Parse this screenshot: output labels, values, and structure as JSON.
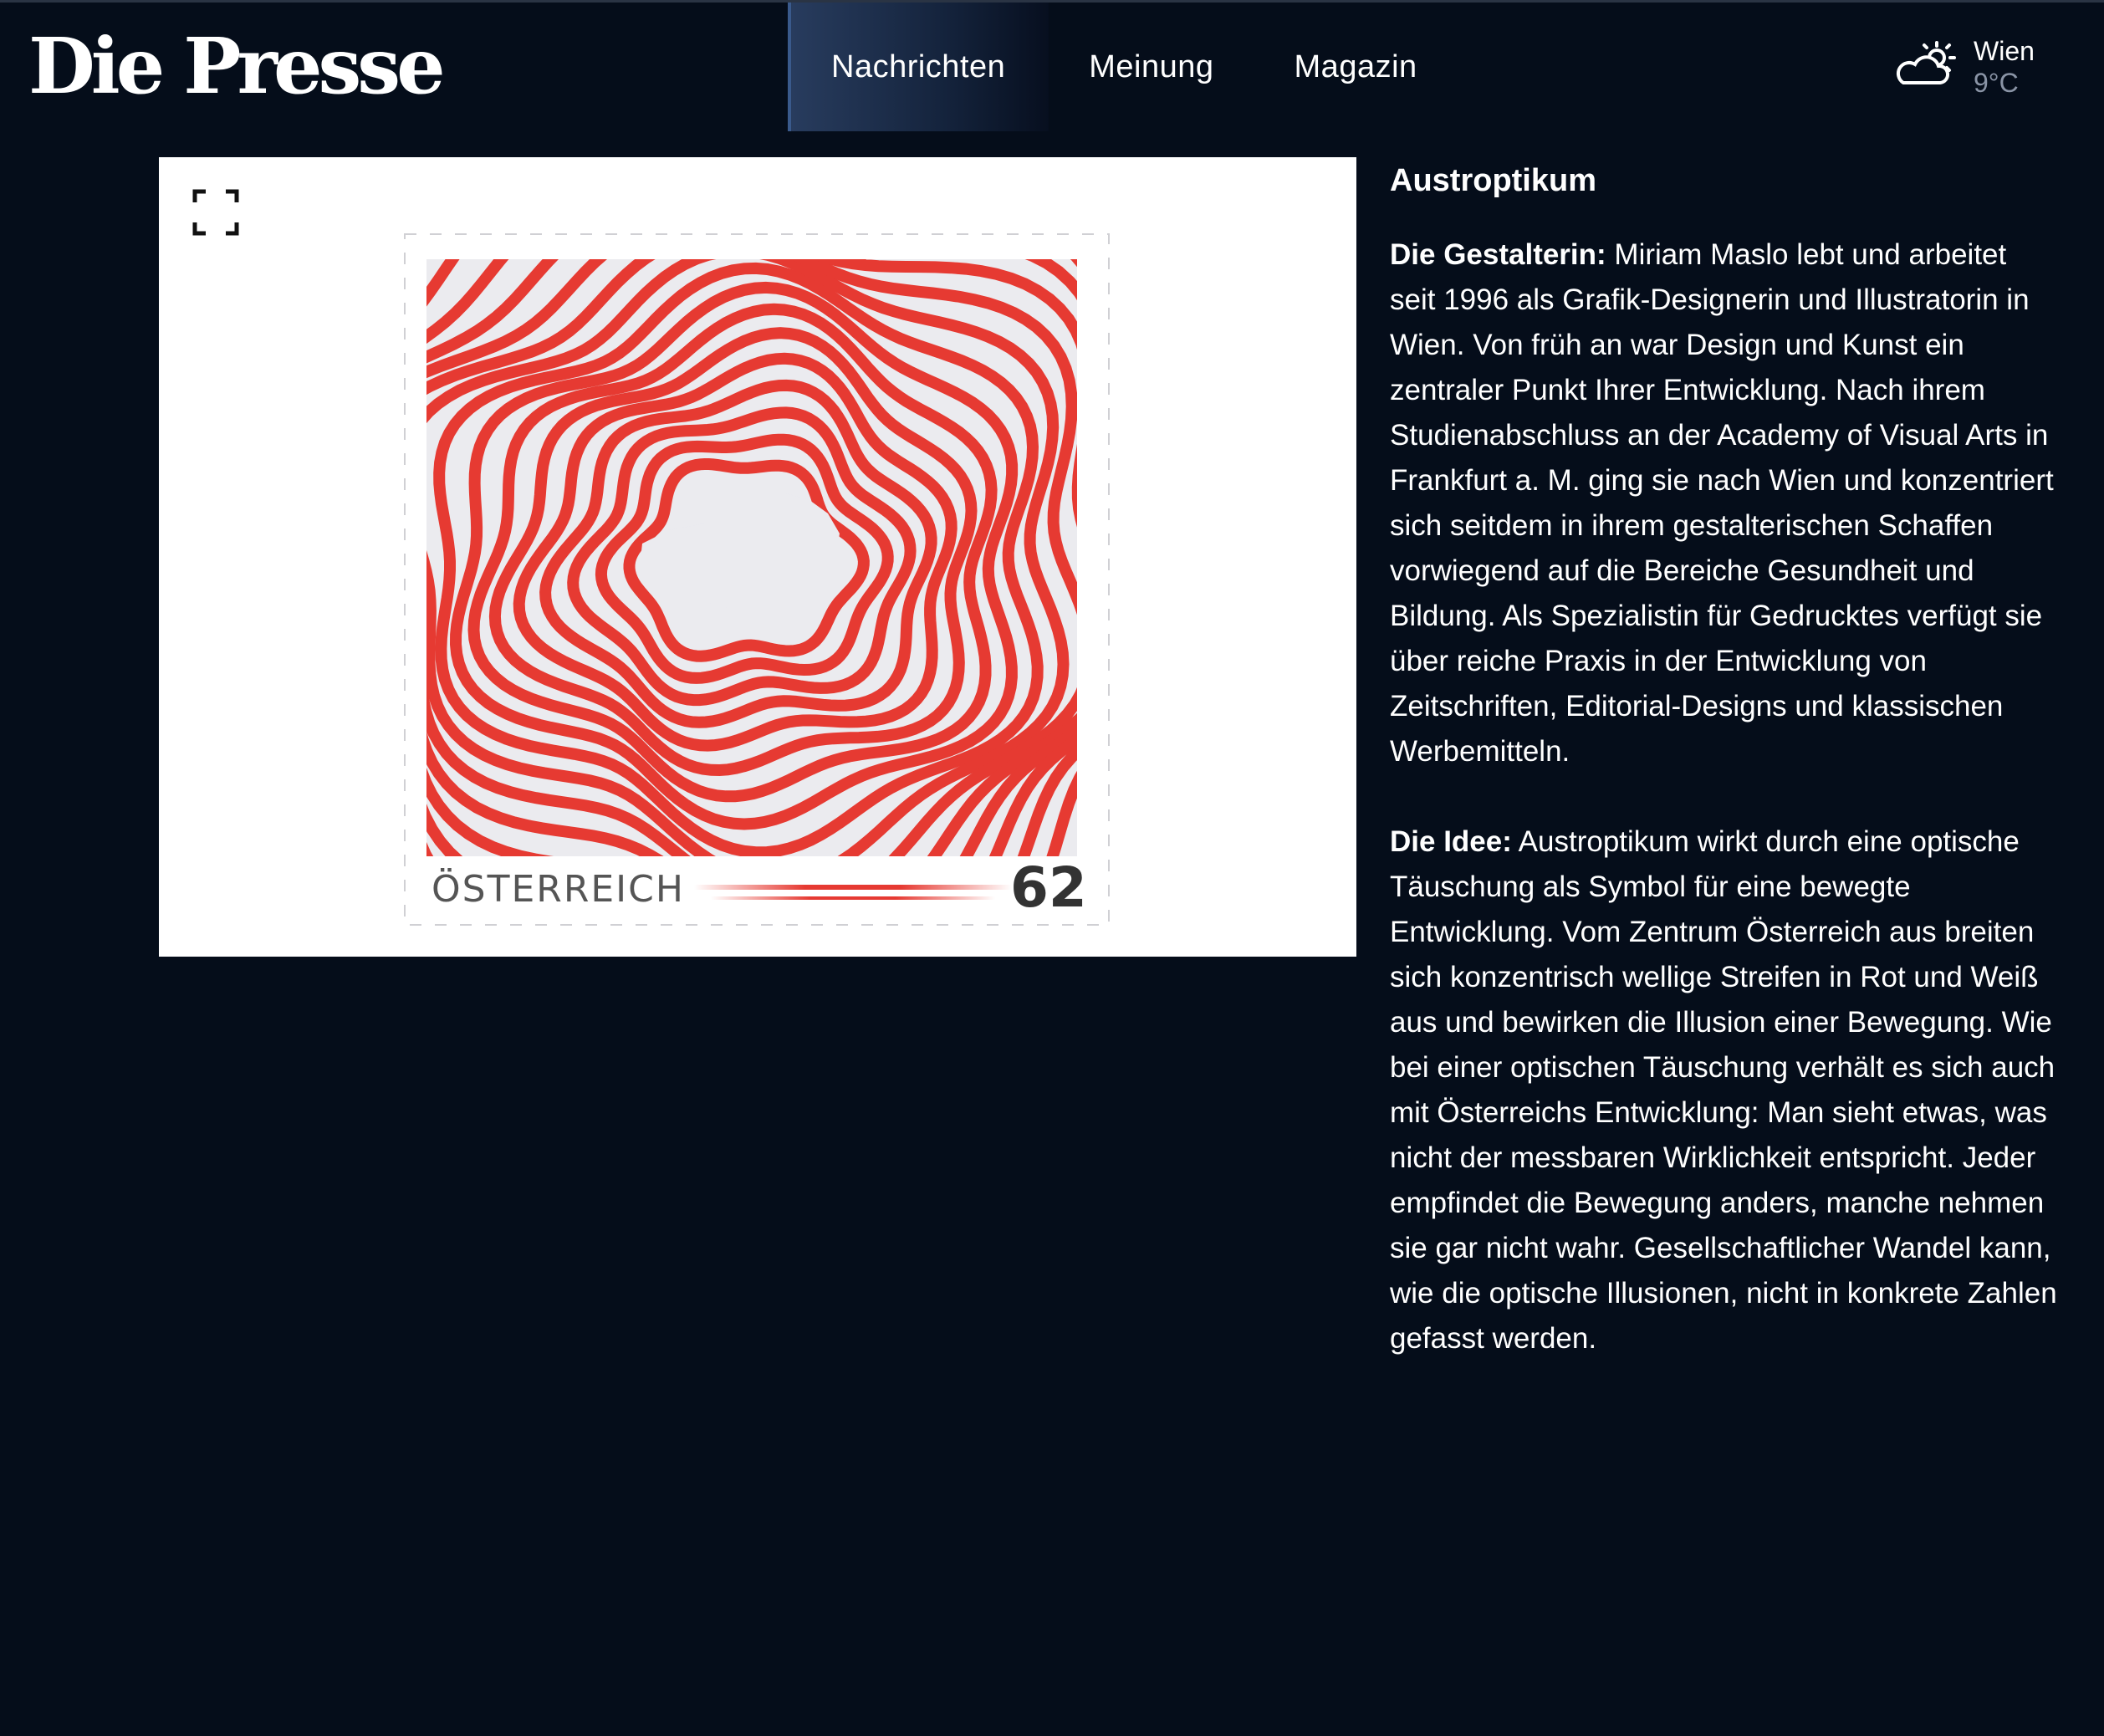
{
  "header": {
    "logo": "Die Presse",
    "nav": [
      {
        "label": "Nachrichten",
        "active": true
      },
      {
        "label": "Meinung",
        "active": false
      },
      {
        "label": "Magazin",
        "active": false
      }
    ],
    "weather": {
      "city": "Wien",
      "temperature": "9°C",
      "icon": "partly-cloudy-icon"
    }
  },
  "image": {
    "expand_icon": "expand-icon",
    "stamp": {
      "country": "ÖSTERREICH",
      "value": "62",
      "colors": {
        "stripe": "#e63a32",
        "background": "#ebebef"
      }
    }
  },
  "article": {
    "title": "Austroptikum",
    "paragraphs": [
      {
        "label": "Die Gestalterin:",
        "text": " Miriam Maslo lebt und arbeitet seit 1996 als Grafik-Designerin und Illustratorin in Wien. Von früh an war Design und Kunst ein zentraler Punkt Ihrer Entwicklung. Nach ihrem Studienabschluss an der Academy of Visual Arts in Frankfurt a. M. ging sie nach Wien und konzentriert sich seitdem in ihrem gestalterischen Schaffen vorwiegend auf die Bereiche Gesundheit und Bildung. Als Spezialistin für Gedrucktes verfügt sie über reiche Praxis in der Entwicklung von Zeitschriften, Editorial-Designs und klassischen Werbemitteln."
      },
      {
        "label": "Die Idee:",
        "text": " Austroptikum wirkt durch eine optische Täuschung als Symbol für eine bewegte Entwicklung. Vom Zentrum Österreich aus breiten sich konzentrisch wellige Streifen in Rot und Weiß aus und bewirken die Illusion einer Bewegung. Wie bei einer optischen Täuschung verhält es sich auch mit Österreichs Entwicklung: Man sieht etwas, was nicht der messbaren Wirklichkeit entspricht. Jeder empfindet die Bewegung anders, manche nehmen sie gar nicht wahr. Gesellschaftlicher Wandel kann, wie die optische Illusionen, nicht in konkrete Zahlen gefasst werden."
      }
    ]
  },
  "colors": {
    "page_background": "#050d1a",
    "nav_active": "#283c5e",
    "weather_temp": "#8a94a6"
  }
}
